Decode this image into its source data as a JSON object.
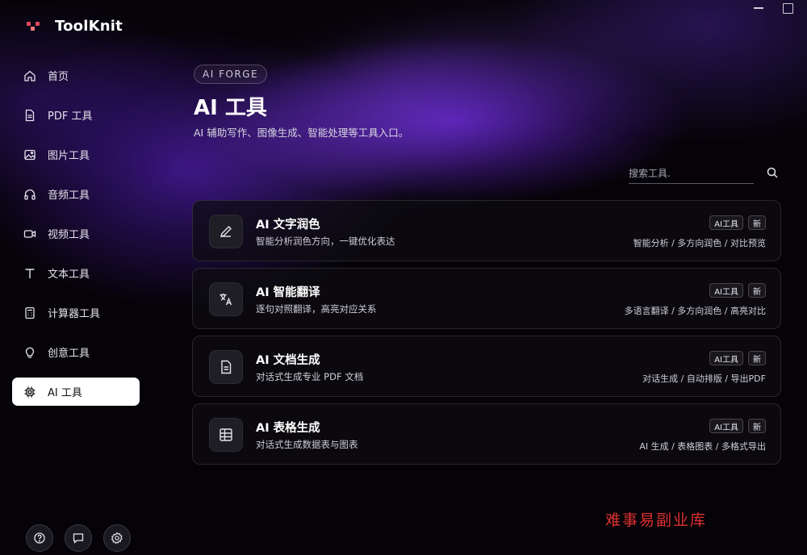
{
  "app": {
    "name": "ToolKnit"
  },
  "window_controls": [
    "minimize",
    "maximize"
  ],
  "sidebar": {
    "items": [
      {
        "label": "首页",
        "icon": "home-icon",
        "active": false
      },
      {
        "label": "PDF 工具",
        "icon": "document-icon",
        "active": false
      },
      {
        "label": "图片工具",
        "icon": "image-icon",
        "active": false
      },
      {
        "label": "音频工具",
        "icon": "headphones-icon",
        "active": false
      },
      {
        "label": "视频工具",
        "icon": "video-icon",
        "active": false
      },
      {
        "label": "文本工具",
        "icon": "text-icon",
        "active": false
      },
      {
        "label": "计算器工具",
        "icon": "calculator-icon",
        "active": false
      },
      {
        "label": "创意工具",
        "icon": "lightbulb-icon",
        "active": false
      },
      {
        "label": "AI 工具",
        "icon": "chip-icon",
        "active": true
      }
    ],
    "bottom_buttons": [
      "help-icon",
      "chat-icon",
      "settings-icon"
    ]
  },
  "main": {
    "badge": "AI FORGE",
    "title": "AI 工具",
    "subtitle": "AI 辅助写作、图像生成、智能处理等工具入口。",
    "search": {
      "placeholder": "搜索工具."
    },
    "cards": [
      {
        "icon": "pen-icon",
        "title": "AI 文字润色",
        "desc": "智能分析润色方向，一键优化表达",
        "tags": [
          "AI工具",
          "新"
        ],
        "features": "智能分析 / 多方向润色 / 对比预览"
      },
      {
        "icon": "translate-icon",
        "title": "AI 智能翻译",
        "desc": "逐句对照翻译，高亮对应关系",
        "tags": [
          "AI工具",
          "新"
        ],
        "features": "多语言翻译 / 多方向润色 / 高亮对比"
      },
      {
        "icon": "file-icon",
        "title": "AI 文档生成",
        "desc": "对话式生成专业 PDF 文档",
        "tags": [
          "AI工具",
          "新"
        ],
        "features": "对话生成 / 自动排版 / 导出PDF"
      },
      {
        "icon": "table-icon",
        "title": "AI 表格生成",
        "desc": "对话式生成数据表与图表",
        "tags": [
          "AI工具",
          "新"
        ],
        "features": "AI 生成 / 表格图表 / 多格式导出"
      }
    ]
  },
  "watermark": "难事易副业库",
  "colors": {
    "accent_purple": "#5c1ebe",
    "background": "#050307",
    "active_nav_bg": "#ffffff",
    "watermark": "#e03030"
  }
}
